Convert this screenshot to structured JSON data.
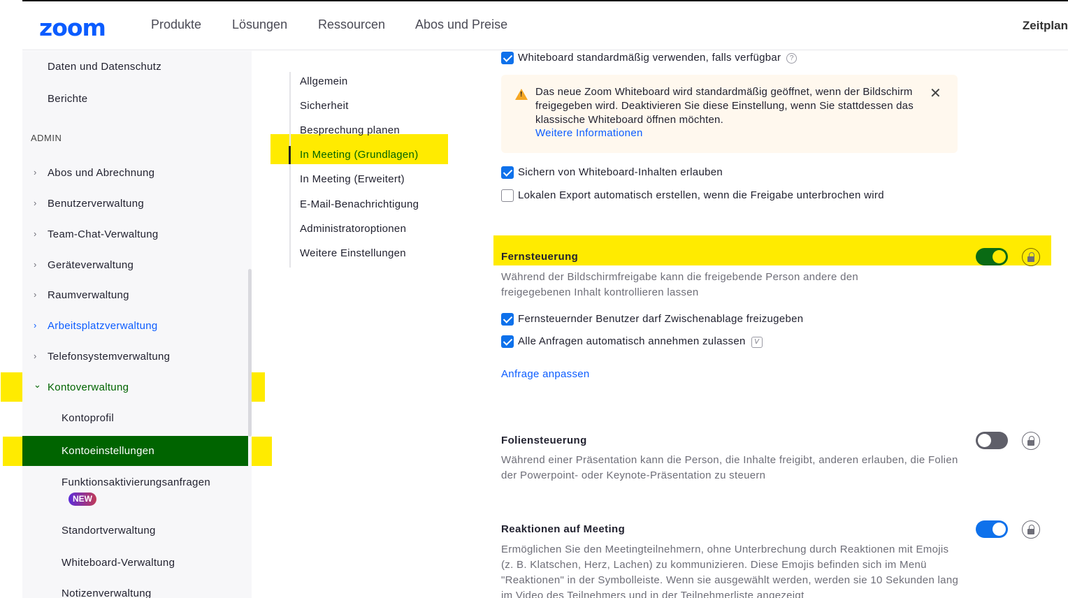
{
  "header": {
    "logo": "zoom",
    "nav": [
      "Produkte",
      "Lösungen",
      "Ressourcen",
      "Abos und Preise"
    ],
    "right_label": "Zeitplan"
  },
  "sidebar": {
    "top_items": [
      "Daten und Datenschutz",
      "Berichte"
    ],
    "section_label": "ADMIN",
    "items": [
      {
        "label": "Abos und Abrechnung",
        "chevron": "›"
      },
      {
        "label": "Benutzerverwaltung",
        "chevron": "›"
      },
      {
        "label": "Team-Chat-Verwaltung",
        "chevron": "›"
      },
      {
        "label": "Geräteverwaltung",
        "chevron": "›"
      },
      {
        "label": "Raumverwaltung",
        "chevron": "›"
      },
      {
        "label": "Arbeitsplatzverwaltung",
        "chevron": "›"
      },
      {
        "label": "Telefonsystemverwaltung",
        "chevron": "›"
      },
      {
        "label": "Kontoverwaltung",
        "chevron": "⌄"
      }
    ],
    "sub_items": [
      "Kontoprofil",
      "Kontoeinstellungen",
      "Funktionsaktivierungsanfragen",
      "Standortverwaltung",
      "Whiteboard-Verwaltung",
      "Notizenverwaltung"
    ],
    "new_badge": "NEW"
  },
  "subnav": {
    "items": [
      "Allgemein",
      "Sicherheit",
      "Besprechung planen",
      "In Meeting (Grundlagen)",
      "In Meeting (Erweitert)",
      "E-Mail-Benachrichtigung",
      "Administratoroptionen",
      "Weitere Einstellungen"
    ],
    "active": "In Meeting (Grundlagen)"
  },
  "content": {
    "whiteboard_default": {
      "label": "Whiteboard standardmäßig verwenden, falls verfügbar",
      "checked": true,
      "help": "?"
    },
    "alert": {
      "text": "Das neue Zoom Whiteboard wird standardmäßig geöffnet, wenn der Bildschirm freigegeben wird. Deaktivieren Sie diese Einstellung, wenn Sie stattdessen das klassische Whiteboard öffnen möchten.",
      "link": "Weitere Informationen",
      "close": "✕"
    },
    "whiteboard_save": {
      "label": "Sichern von Whiteboard-Inhalten erlauben",
      "checked": true
    },
    "whiteboard_export": {
      "label": "Lokalen Export automatisch erstellen, wenn die Freigabe unterbrochen wird",
      "checked": false
    },
    "remote_control": {
      "title": "Fernsteuerung",
      "desc": "Während der Bildschirmfreigabe kann die freigebende Person andere den freigegebenen Inhalt kontrollieren lassen",
      "enabled": true,
      "clipboard": {
        "label": "Fernsteuernder Benutzer darf Zwischenablage freizugeben",
        "checked": true
      },
      "auto_accept": {
        "label": "Alle Anfragen automatisch annehmen zulassen",
        "checked": true,
        "badge": "V"
      },
      "link": "Anfrage anpassen"
    },
    "slide_control": {
      "title": "Foliensteuerung",
      "desc": "Während einer Präsentation kann die Person, die Inhalte freigibt, anderen erlauben, die Folien der Powerpoint- oder Keynote-Präsentation zu steuern",
      "enabled": false
    },
    "reactions": {
      "title": "Reaktionen auf Meeting",
      "desc": "Ermöglichen Sie den Meetingteilnehmern, ohne Unterbrechung durch Reaktionen mit Emojis (z. B. Klatschen, Herz, Lachen) zu kommunizieren. Diese Emojis befinden sich im Menü \"Reaktionen\" in der Symbolleiste. Wenn sie ausgewählt werden, werden sie 10 Sekunden lang im Video des Teilnehmers und in der Teilnehmerliste angezeigt",
      "enabled": true
    }
  },
  "colors": {
    "brand": "#0b5cff",
    "active_green": "#006400",
    "highlight": "#ffeb00",
    "toggle_blue": "#0e71eb"
  }
}
